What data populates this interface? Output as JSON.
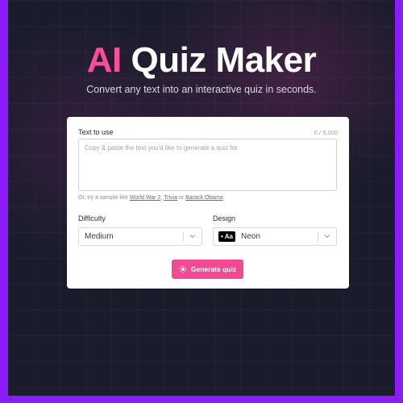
{
  "header": {
    "title_accent": "AI",
    "title_rest": "Quiz Maker",
    "subtitle": "Convert any text into an interactive quiz in seconds."
  },
  "form": {
    "text_label": "Text to use",
    "char_count": "0 / 5,000",
    "text_placeholder": "Copy & paste the text you'd like to generate a quiz for.",
    "samples_prefix": "Or, try a sample like",
    "samples": [
      "World War 2",
      "Trivia",
      "Barack Obama"
    ],
    "samples_sep1": ",",
    "samples_sep2": "or",
    "difficulty_label": "Difficulty",
    "difficulty_value": "Medium",
    "design_label": "Design",
    "design_badge": "Aa",
    "design_value": "Neon",
    "generate_label": "Generate quiz"
  },
  "colors": {
    "accent": "#ff4d9d",
    "button": "#ef4a92",
    "frame_border": "#8a1bff",
    "background": "#1a1c2b"
  },
  "icons": {
    "generate": "sparkle-icon",
    "select": "chevron-down-icon"
  }
}
